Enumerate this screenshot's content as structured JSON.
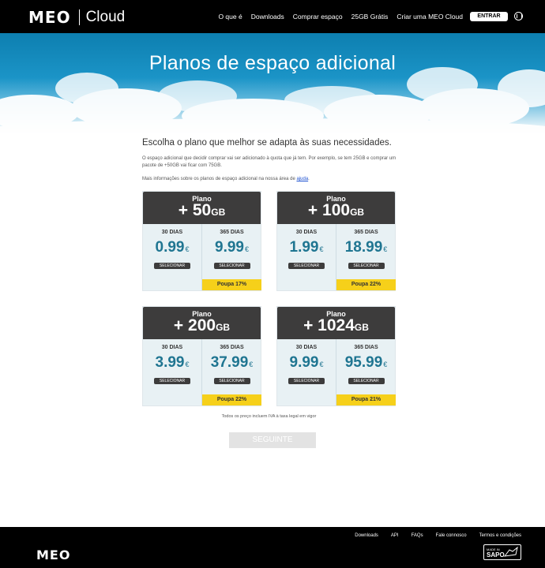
{
  "header": {
    "logo_meo": "MEO",
    "logo_cloud": "Cloud",
    "nav": [
      "O que é",
      "Downloads",
      "Comprar espaço",
      "25GB Grátis",
      "Criar uma MEO Cloud"
    ],
    "login_label": "ENTRAR",
    "menu_icon": "circle-menu-icon"
  },
  "hero": {
    "title": "Planos de espaço adicional"
  },
  "intro": {
    "headline": "Escolha o plano que melhor se adapta às suas necessidades.",
    "paragraph": "O espaço adicional que decidir comprar vai ser adicionado à quota que já tem. Por exemplo, se tem 25GB e comprar um pacote de +50GB vai ficar com 75GB.",
    "more_info_prefix": "Mais informações sobre os planos de espaço adicional na nossa área de",
    "more_info_link": "ajuda",
    "more_info_suffix": "."
  },
  "plans": [
    {
      "label": "Plano",
      "amount": "+ 50",
      "unit": "GB",
      "monthly": {
        "period": "30 DIAS",
        "price": "0.99",
        "currency": "€",
        "button": "SELECIONAR"
      },
      "yearly": {
        "period": "365 DIAS",
        "price": "9.99",
        "currency": "€",
        "button": "SELECIONAR",
        "save": "Poupa 17%"
      }
    },
    {
      "label": "Plano",
      "amount": "+ 100",
      "unit": "GB",
      "monthly": {
        "period": "30 DIAS",
        "price": "1.99",
        "currency": "€",
        "button": "SELECIONAR"
      },
      "yearly": {
        "period": "365 DIAS",
        "price": "18.99",
        "currency": "€",
        "button": "SELECIONAR",
        "save": "Poupa 22%"
      }
    },
    {
      "label": "Plano",
      "amount": "+ 200",
      "unit": "GB",
      "monthly": {
        "period": "30 DIAS",
        "price": "3.99",
        "currency": "€",
        "button": "SELECIONAR"
      },
      "yearly": {
        "period": "365 DIAS",
        "price": "37.99",
        "currency": "€",
        "button": "SELECIONAR",
        "save": "Poupa 22%"
      }
    },
    {
      "label": "Plano",
      "amount": "+ 1024",
      "unit": "GB",
      "monthly": {
        "period": "30 DIAS",
        "price": "9.99",
        "currency": "€",
        "button": "SELECIONAR"
      },
      "yearly": {
        "period": "365 DIAS",
        "price": "95.99",
        "currency": "€",
        "button": "SELECIONAR",
        "save": "Poupa 21%"
      }
    }
  ],
  "note": "Todos os preço incluem IVA à taxa legal em vigor",
  "next_button": "SEGUINTE",
  "footer": {
    "links": [
      "Downloads",
      "API",
      "FAQs",
      "Fale connosco",
      "Termos e condições"
    ],
    "logo": "MEO",
    "badge_small": "MADE IN",
    "badge_big": "SAPO"
  },
  "colors": {
    "header_bg": "#000000",
    "card_head": "#3d3c3c",
    "price": "#1f7591",
    "save_bg": "#f6d01a"
  }
}
